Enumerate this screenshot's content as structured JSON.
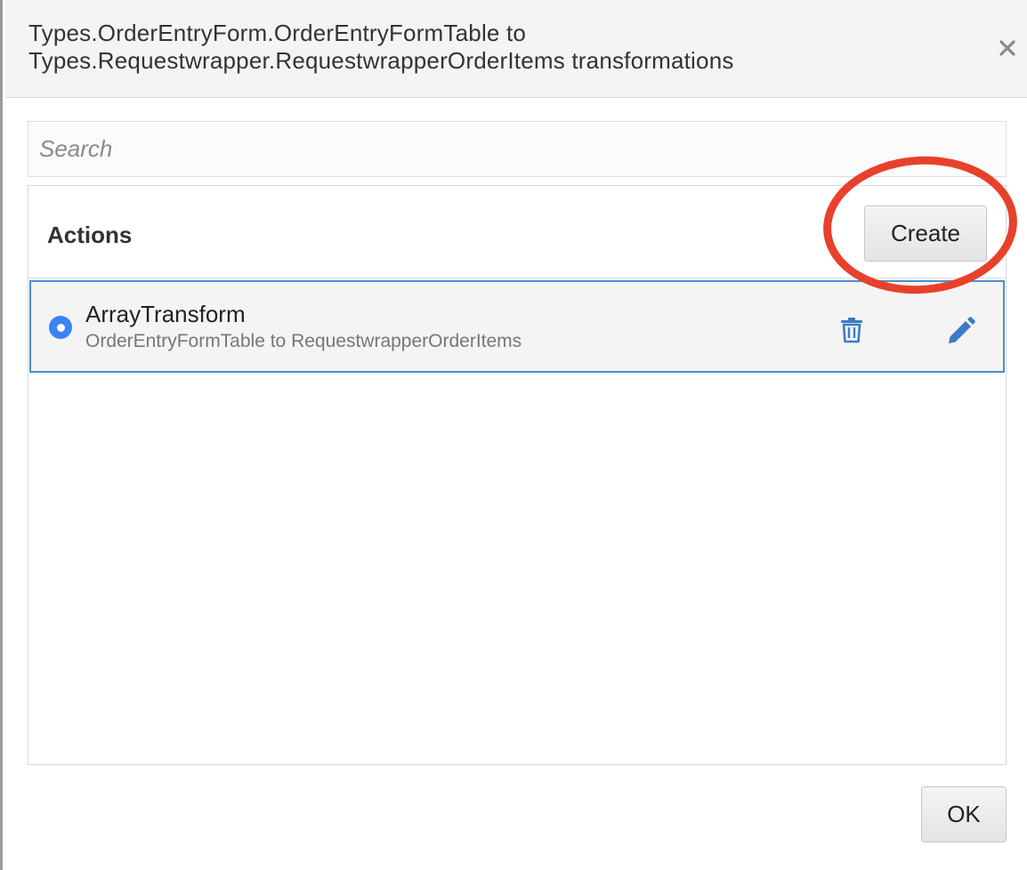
{
  "dialog": {
    "title_line1": "Types.OrderEntryForm.OrderEntryFormTable to",
    "title_line2": "Types.Requestwrapper.RequestwrapperOrderItems transformations",
    "close_icon": "close-icon"
  },
  "search": {
    "placeholder": "Search",
    "value": ""
  },
  "actions_panel": {
    "title": "Actions",
    "create_label": "Create",
    "highlight_color": "#e8412b",
    "items": [
      {
        "name": "ArrayTransform",
        "description": "OrderEntryFormTable to RequestwrapperOrderItems",
        "selected": true,
        "delete_icon": "trash-icon",
        "edit_icon": "pencil-icon"
      }
    ]
  },
  "footer": {
    "ok_label": "OK"
  },
  "colors": {
    "accent": "#3b82f6",
    "selected_border": "#4a8ed0",
    "icon_blue": "#3a7cc4",
    "header_bg": "#f4f4f4"
  }
}
